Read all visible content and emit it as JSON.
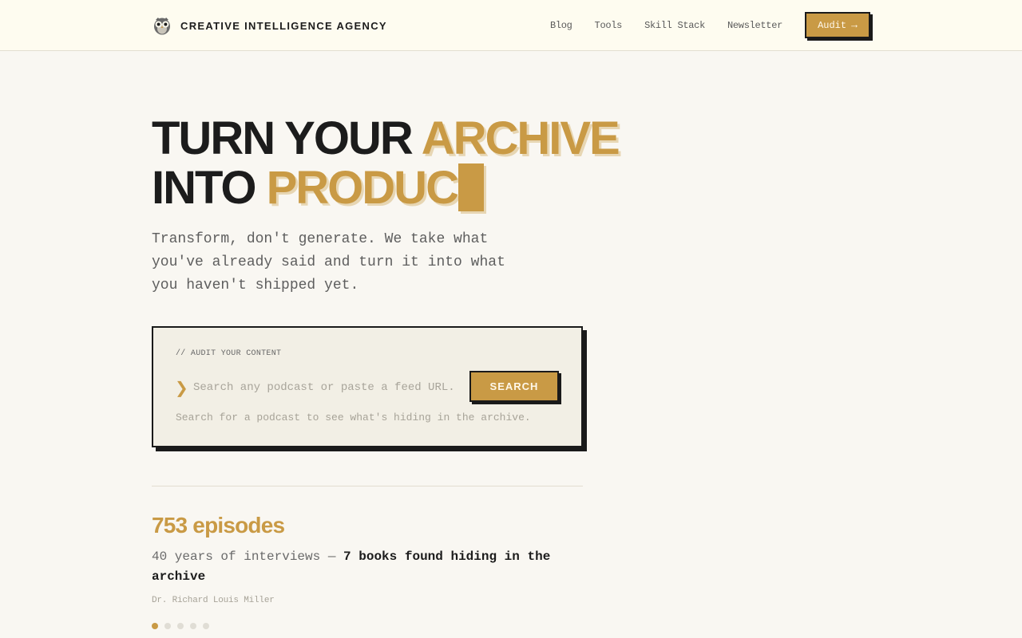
{
  "header": {
    "brand_name": "CREATIVE INTELLIGENCE AGENCY",
    "brand_icon": "owl-icon",
    "nav": [
      {
        "label": "Blog"
      },
      {
        "label": "Tools"
      },
      {
        "label": "Skill Stack"
      },
      {
        "label": "Newsletter"
      }
    ],
    "cta_label": "Audit",
    "cta_arrow": "→"
  },
  "hero": {
    "title_line1_plain": "TURN YOUR ",
    "title_line1_accent": "ARCHIVE",
    "title_line2_plain": "INTO ",
    "title_line2_accent": "PRODUC",
    "subtitle": "Transform, don't generate. We take what you've already said and turn it into what you haven't shipped yet."
  },
  "audit": {
    "kicker": "// AUDIT YOUR CONTENT",
    "prompt_glyph": "❯",
    "placeholder": "Search any podcast or paste a feed URL...",
    "value": "",
    "button_label": "SEARCH",
    "hint": "Search for a podcast to see what's hiding in the archive."
  },
  "stats": {
    "count": "753 episodes",
    "lead": "40 years of interviews — ",
    "highlight": "7 books found hiding in the archive",
    "author": "Dr. Richard Louis Miller",
    "active_slide": 1,
    "total_slides": 5
  },
  "colors": {
    "accent": "#c99a45",
    "ink": "#1c1c1c",
    "page_bg": "#f9f7f2",
    "header_bg": "#fefcf0",
    "card_bg": "#f2efe5"
  }
}
